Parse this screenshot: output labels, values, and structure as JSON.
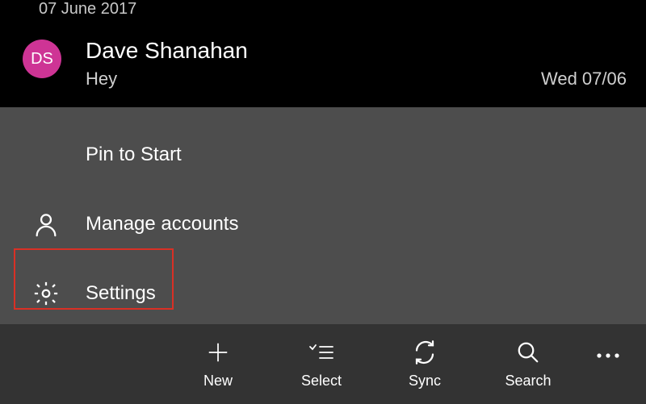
{
  "header": {
    "date": "07 June 2017"
  },
  "message": {
    "avatar_initials": "DS",
    "sender": "Dave Shanahan",
    "subject": "Hey",
    "date": "Wed 07/06"
  },
  "menu": {
    "pin": "Pin to Start",
    "manage": "Manage accounts",
    "settings": "Settings"
  },
  "bottombar": {
    "new": "New",
    "select": "Select",
    "sync": "Sync",
    "search": "Search"
  }
}
